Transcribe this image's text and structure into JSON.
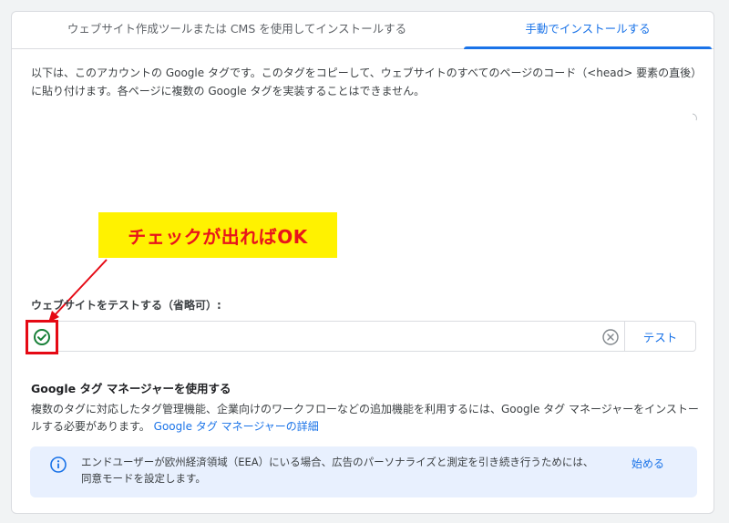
{
  "tabs": [
    {
      "label": "ウェブサイト作成ツールまたは CMS を使用してインストールする"
    },
    {
      "label": "手動でインストールする"
    }
  ],
  "intro": {
    "line1": "以下は、このアカウントの Google タグです。このタグをコピーして、ウェブサイトのすべてのページのコード（<head> 要素の直後）",
    "line2": "に貼り付けます。各ページに複数の Google タグを実装することはできません。"
  },
  "callout": {
    "text": "チェックが出ればOK"
  },
  "test_site": {
    "label": "ウェブサイトをテストする（省略可）:",
    "input_value": "",
    "test_button": "テスト"
  },
  "gtm": {
    "heading": "Google タグ マネージャーを使用する",
    "body_line1": "複数のタグに対応したタグ管理機能、企業向けのワークフローなどの追加機能を利用するには、Google タグ マネージャーをインストー",
    "body_line2": "ルする必要があります。",
    "link": "Google タグ マネージャーの詳細"
  },
  "info_banner": {
    "line1": "エンドユーザーが欧州経済領域（EEA）にいる場合、広告のパーソナライズと測定を引き続き行うためには、",
    "line2": "同意モードを設定します。",
    "action": "始める"
  },
  "colors": {
    "accent": "#1a73e8",
    "highlight_red": "#e50914",
    "callout_bg": "#fff200",
    "success_green": "#188038",
    "banner_bg": "#e8f0fe"
  },
  "icons": [
    "check-circle-icon",
    "clear-icon",
    "info-icon"
  ]
}
